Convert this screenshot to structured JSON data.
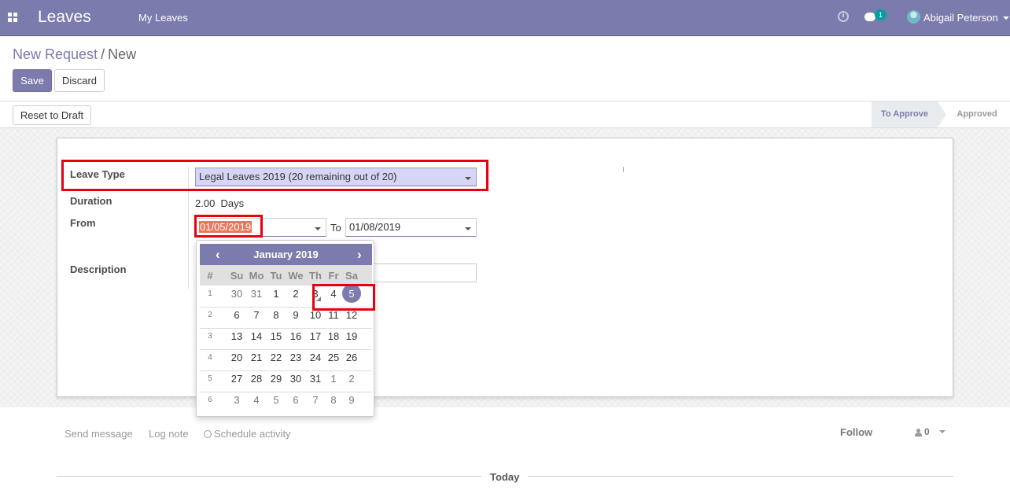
{
  "navbar": {
    "app_name": "Leaves",
    "menu": "My Leaves",
    "chat_count": "1",
    "user_name": "Abigail Peterson",
    "color": "#7c7bad"
  },
  "breadcrumb": {
    "parent": "New Request",
    "separator": "/",
    "current": "New"
  },
  "buttons": {
    "save": "Save",
    "discard": "Discard",
    "reset": "Reset to Draft"
  },
  "statusbar": {
    "active": "To Approve",
    "next": "Approved"
  },
  "form": {
    "leave_type_label": "Leave Type",
    "leave_type_value": "Legal Leaves 2019 (20 remaining out of 20)",
    "duration_label": "Duration",
    "duration_value": "2.00",
    "duration_unit": "Days",
    "from_label": "From",
    "from_value": "01/05/2019",
    "to_label": "To",
    "to_value": "01/08/2019",
    "description_label": "Description"
  },
  "datepicker": {
    "month": "January 2019",
    "week_header": "#",
    "weekdays": [
      "Su",
      "Mo",
      "Tu",
      "We",
      "Th",
      "Fr",
      "Sa"
    ],
    "weeks": [
      {
        "num": "1",
        "days": [
          "30",
          "31",
          "1",
          "2",
          "3",
          "4",
          "5"
        ]
      },
      {
        "num": "2",
        "days": [
          "6",
          "7",
          "8",
          "9",
          "10",
          "11",
          "12"
        ]
      },
      {
        "num": "3",
        "days": [
          "13",
          "14",
          "15",
          "16",
          "17",
          "18",
          "19"
        ]
      },
      {
        "num": "4",
        "days": [
          "20",
          "21",
          "22",
          "23",
          "24",
          "25",
          "26"
        ]
      },
      {
        "num": "5",
        "days": [
          "27",
          "28",
          "29",
          "30",
          "31",
          "1",
          "2"
        ]
      },
      {
        "num": "6",
        "days": [
          "3",
          "4",
          "5",
          "6",
          "7",
          "8",
          "9"
        ]
      }
    ],
    "selected_day": "5",
    "today_day": "3"
  },
  "chatter": {
    "send_message": "Send message",
    "log_note": "Log note",
    "schedule_activity": "Schedule activity",
    "follow": "Follow",
    "followers_count": "0",
    "today": "Today"
  }
}
